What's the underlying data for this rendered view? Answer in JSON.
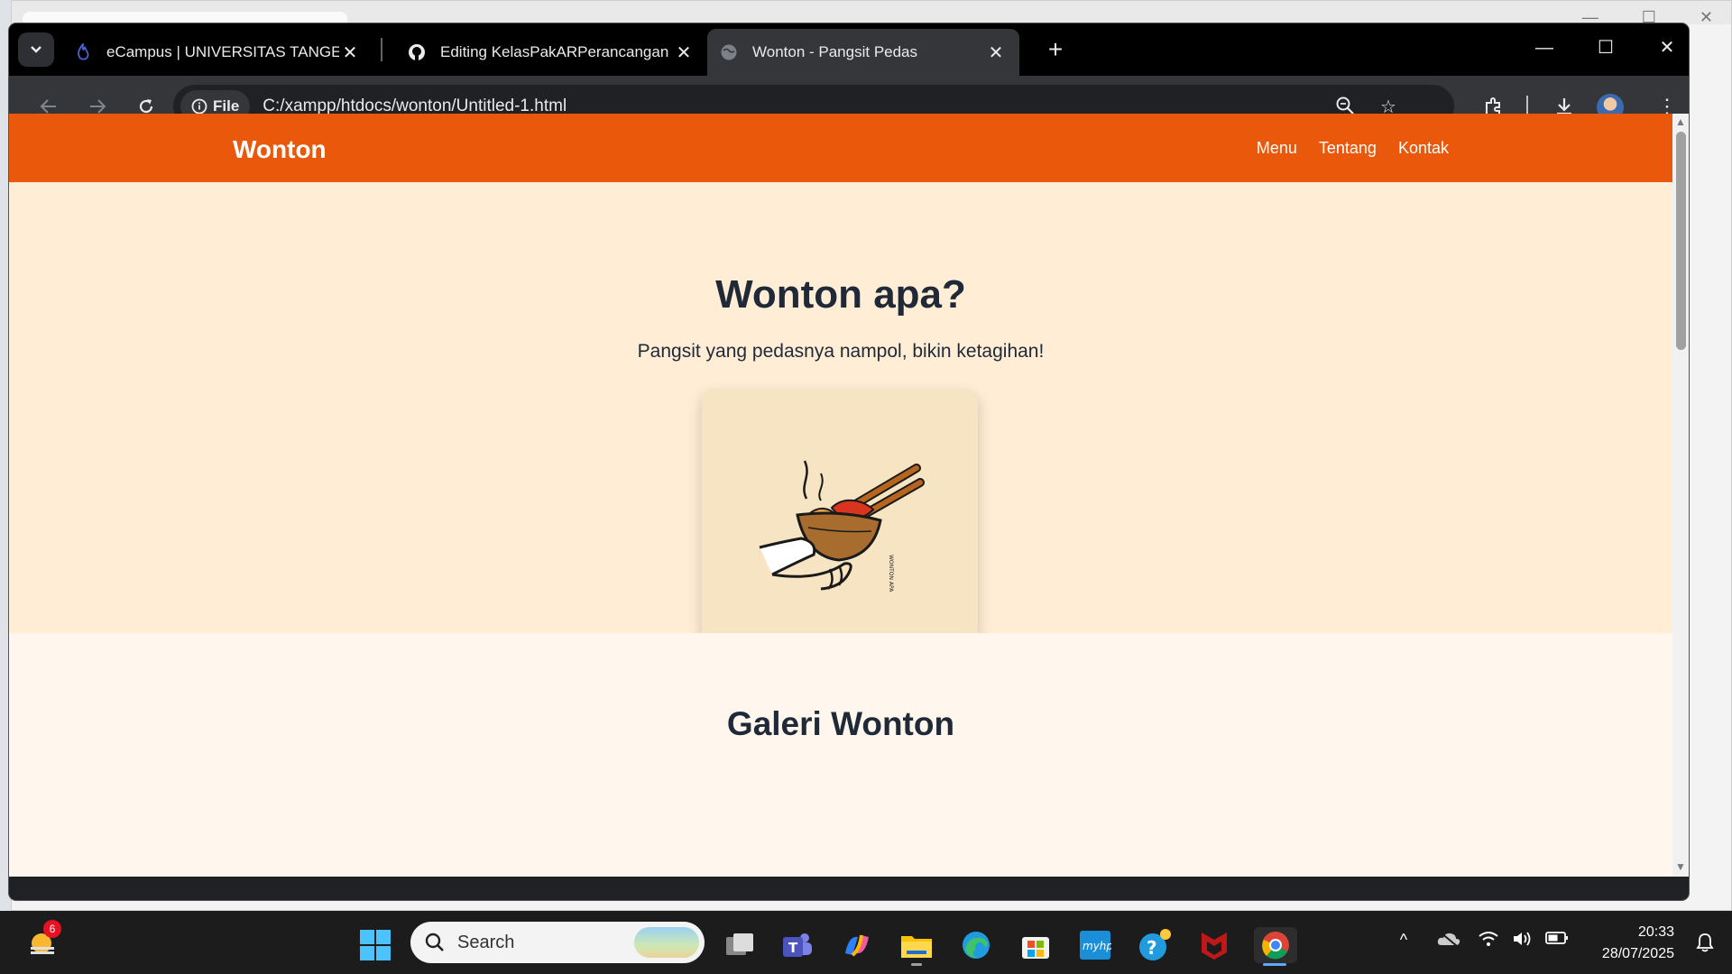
{
  "browser": {
    "tabs": [
      {
        "title": "eCampus | UNIVERSITAS TANGE",
        "active": false,
        "icon": "flame-icon"
      },
      {
        "title": "Editing KelasPakARPerancangan",
        "active": false,
        "icon": "github-icon"
      },
      {
        "title": "Wonton - Pangsit Pedas",
        "active": true,
        "icon": "globe-icon"
      }
    ],
    "address": {
      "chip": "File",
      "url": "C:/xampp/htdocs/wonton/Untitled-1.html"
    }
  },
  "page": {
    "brand": "Wonton",
    "nav": [
      "Menu",
      "Tentang",
      "Kontak"
    ],
    "hero": {
      "title": "Wonton apa?",
      "subtitle": "Pangsit yang pedasnya nampol, bikin ketagihan!",
      "logo_text": "WONTON APA"
    },
    "gallery_title": "Galeri Wonton",
    "colors": {
      "nav": "#ea580c",
      "hero": "#ffedd5",
      "text": "#1f2937"
    }
  },
  "taskbar": {
    "search_placeholder": "Search",
    "weather_badge": "6",
    "time": "20:33",
    "date": "28/07/2025"
  }
}
